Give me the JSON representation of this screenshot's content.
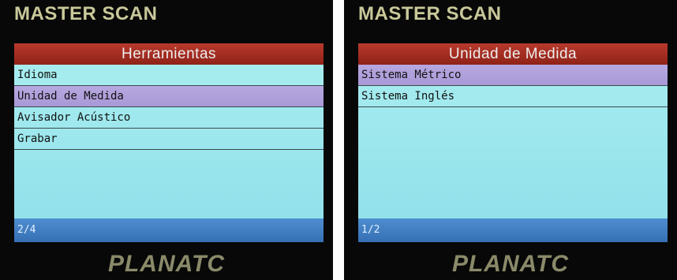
{
  "left_device": {
    "brand": "MASTER SCAN",
    "title": "Herramientas",
    "items": [
      {
        "label": "Idioma"
      },
      {
        "label": "Unidad de Medida",
        "selected": true
      },
      {
        "label": "Avisador Acústico"
      },
      {
        "label": "Grabar"
      }
    ],
    "page": "2/4",
    "logo": "PLANATC"
  },
  "right_device": {
    "brand": "MASTER SCAN",
    "title": "Unidad de Medida",
    "items": [
      {
        "label": "Sistema Métrico",
        "selected": true
      },
      {
        "label": "Sistema Inglés"
      }
    ],
    "page": "1/2",
    "logo": "PLANATC"
  },
  "colors": {
    "title_bar": "#a32d22",
    "screen_bg": "#9fe6ee",
    "selection": "#b0a0dc",
    "status_bar": "#4280c4"
  }
}
